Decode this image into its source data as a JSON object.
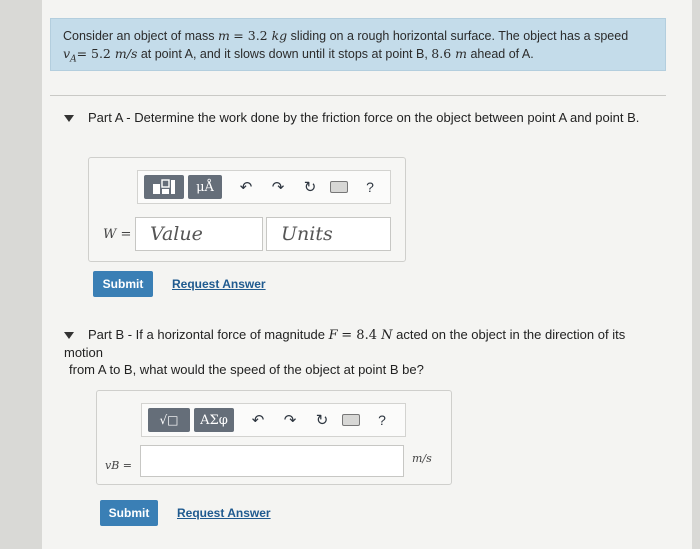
{
  "problem": {
    "line1_before_mass": "Consider an object of mass ",
    "mass_symbol": "m",
    "mass_eq": "= 3.2 ",
    "mass_unit": "kg",
    "line1_after_mass": " sliding on a rough horizontal surface. The object has a speed",
    "speed_symbol": "v",
    "speed_sub": "A",
    "speed_eq": "= 5.2 ",
    "speed_unit": "m/s",
    "line2_middle": " at point A, and it slows down until it stops at point B, ",
    "distance_value": "8.6 ",
    "distance_unit": "m",
    "line2_end": " ahead of A."
  },
  "partA": {
    "title": "Part A - Determine the work done by the friction force on the object between point A and point B.",
    "var_label": "W =",
    "value_placeholder": "Value",
    "units_placeholder": "Units",
    "toolbar_mu": "μÅ",
    "toolbar_help": "?",
    "submit_label": "Submit",
    "request_label": "Request Answer"
  },
  "partB": {
    "title_before": "Part B - If a horizontal force of magnitude ",
    "force_symbol": "F",
    "force_eq": "= 8.4 ",
    "force_unit": "N",
    "title_after": " acted on the object in the direction of its motion",
    "title_line2": "from A to B, what would the speed of the object at point B be?",
    "var_label": "vB =",
    "units_text": "m/s",
    "toolbar_root": "√□",
    "toolbar_greek": "ΑΣφ",
    "toolbar_help": "?",
    "submit_label": "Submit",
    "request_label": "Request Answer"
  },
  "icons": {
    "undo": "undo-icon",
    "redo": "redo-icon",
    "reset": "reset-icon",
    "keyboard": "keyboard-icon",
    "help": "help-icon"
  }
}
